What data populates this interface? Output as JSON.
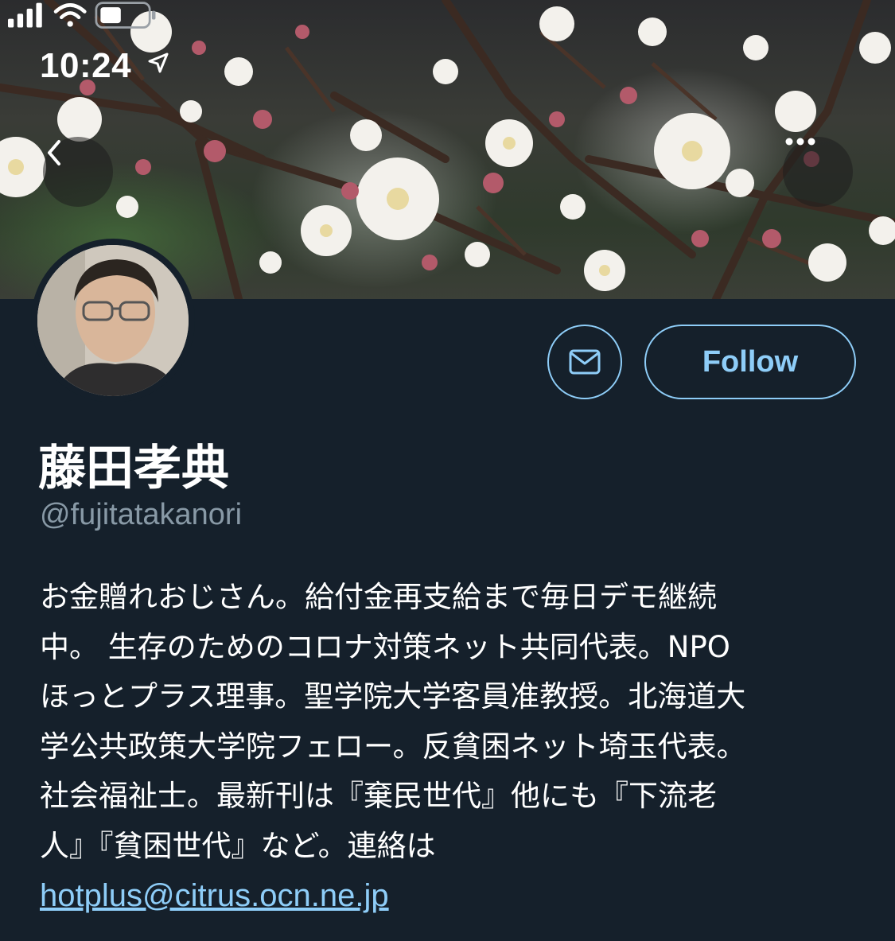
{
  "status_bar": {
    "time": "10:24"
  },
  "profile": {
    "display_name": "藤田孝典",
    "handle": "@fujitatakanori",
    "follow_label": "Follow",
    "bio_lines": [
      "お金贈れおじさん。給付金再支給まで毎日デモ継続",
      "中。 生存のためのコロナ対策ネット共同代表。NPO",
      "ほっとプラス理事。聖学院大学客員准教授。北海道大",
      "学公共政策大学院フェロー。反貧困ネット埼玉代表。",
      "社会福祉士。最新刊は『棄民世代』他にも『下流老",
      "人』『貧困世代』など。連絡は"
    ],
    "contact_link": "hotplus@citrus.ocn.ne.jp"
  },
  "colors": {
    "background": "#15202b",
    "accent": "#8ecdf8",
    "secondary_text": "#8899a6"
  },
  "icons": [
    "location-arrow-icon",
    "signal-icon",
    "wifi-icon",
    "battery-icon",
    "back-chevron-icon",
    "more-dots-icon",
    "envelope-icon"
  ]
}
